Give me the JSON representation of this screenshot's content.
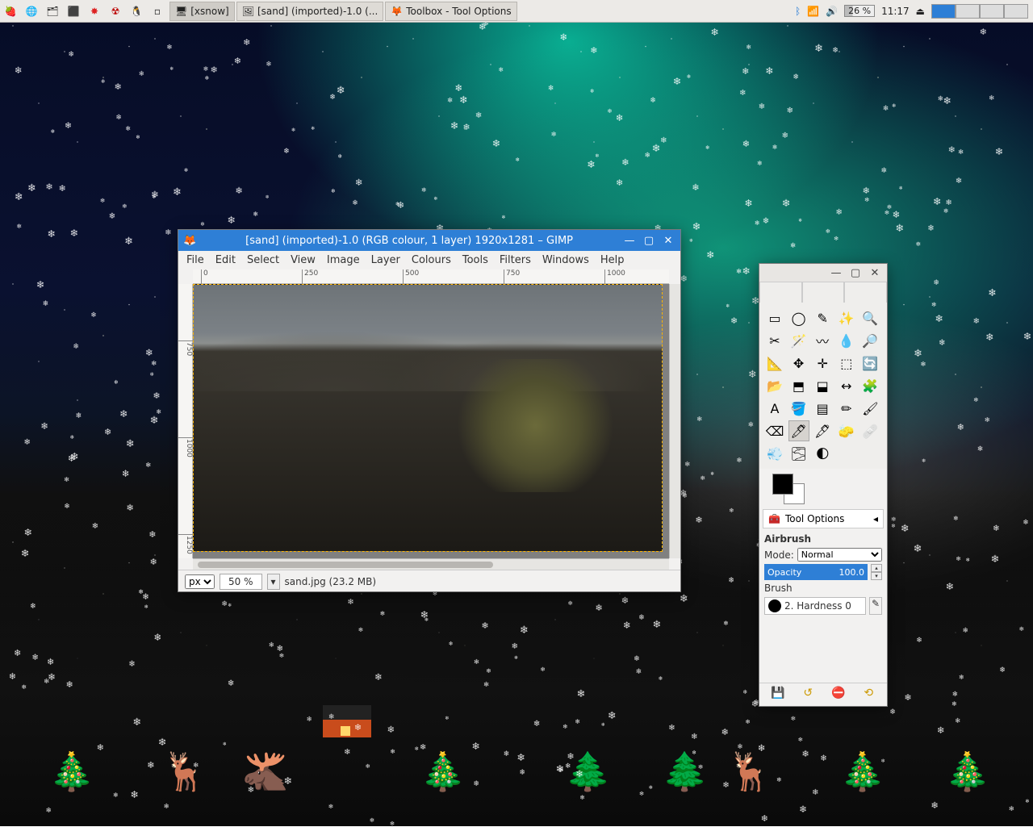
{
  "panel": {
    "launchers": [
      "raspberry",
      "globe",
      "files",
      "terminal",
      "star-red",
      "bomb",
      "penguin",
      "blank"
    ],
    "tasks": [
      {
        "icon": "🖥",
        "label": "[xsnow]"
      },
      {
        "icon": "🖼",
        "label": "[sand] (imported)-1.0 (..."
      },
      {
        "icon": "🦊",
        "label": "Toolbox - Tool Options"
      }
    ],
    "tray": {
      "battery": "26 %",
      "clock": "11:17"
    }
  },
  "gimp_window": {
    "title": "[sand] (imported)-1.0 (RGB colour, 1 layer) 1920x1281 – GIMP",
    "menu": [
      "File",
      "Edit",
      "Select",
      "View",
      "Image",
      "Layer",
      "Colours",
      "Tools",
      "Filters",
      "Windows",
      "Help"
    ],
    "ruler_h": [
      "0",
      "250",
      "500",
      "750",
      "1000"
    ],
    "ruler_v": [
      "750",
      "1000",
      "1250"
    ],
    "status": {
      "units": "px",
      "zoom": "50 %",
      "file": "sand.jpg (23.2 MB)"
    }
  },
  "toolbox": {
    "tools": [
      "rect-select",
      "ellipse-select",
      "free-select",
      "fuzzy-select",
      "by-color-select",
      "scissors",
      "foreground-select",
      "paths",
      "color-picker",
      "zoom",
      "measure",
      "move",
      "align",
      "crop",
      "rotate",
      "scale",
      "shear",
      "perspective",
      "flip",
      "cage",
      "text",
      "bucket-fill",
      "blend",
      "pencil",
      "paintbrush",
      "eraser",
      "airbrush",
      "ink",
      "clone",
      "heal",
      "smudge",
      "blur",
      "dodge",
      ""
    ],
    "tool_glyphs": [
      "▭",
      "◯",
      "✎",
      "✨",
      "🔍",
      "✂",
      "🪄",
      "〰",
      "💧",
      "🔎",
      "📐",
      "✥",
      "✛",
      "⬚",
      "🔄",
      "📂",
      "⬒",
      "⬓",
      "↔",
      "🧩",
      "A",
      "🪣",
      "▤",
      "✏",
      "🖌",
      "⌫",
      "🖊",
      "🖋",
      "🧽",
      "🩹",
      "💨",
      "🌫",
      "🌓",
      ""
    ],
    "selected_tool_index": 26,
    "tool_options_title": "Tool Options",
    "active_tool_name": "Airbrush",
    "mode_label": "Mode:",
    "mode_value": "Normal",
    "opacity_label": "Opacity",
    "opacity_value": "100.0",
    "brush_label": "Brush",
    "brush_value": "2. Hardness 0"
  }
}
